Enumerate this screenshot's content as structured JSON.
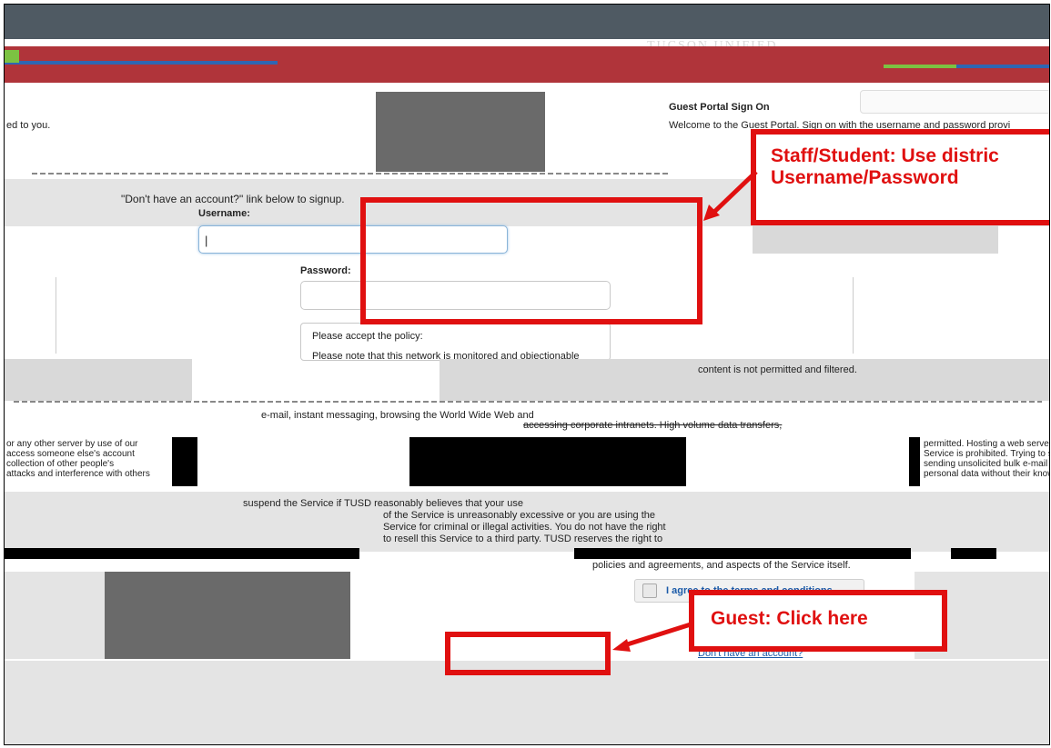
{
  "header": {
    "banner_text": "TUCSON UNIFIED",
    "colors": {
      "top_band": "#4f5a63",
      "red_band": "#b0343a",
      "accent_green": "#7cc242",
      "accent_blue": "#2f66b3"
    }
  },
  "intro": {
    "left_fragment": "ed to you.",
    "signup_hint": "\"Don't have an account?\" link below to signup."
  },
  "portal": {
    "title": "Guest Portal Sign On",
    "welcome": "Welcome to the Guest Portal. Sign on with the username and password provi"
  },
  "form": {
    "username_label": "Username:",
    "username_value": "|",
    "password_label": "Password:",
    "password_value": ""
  },
  "policy": {
    "heading": "Please accept the policy:",
    "line1": "Please note that this network is monitored and objectionable",
    "line2": "content is not permitted and filtered.",
    "email_line": "e-mail, instant messaging, browsing the World Wide Web and",
    "intranet_line": "accessing corporate intranets. High volume data transfers,",
    "left_col": [
      "or any other server by use of our",
      "access someone else's account",
      "collection of other people's",
      "attacks and interference with others"
    ],
    "right_col": [
      "permitted. Hosting a web server",
      "Service is prohibited. Trying to s",
      "sending unsolicited bulk e-mail",
      "personal data without their know"
    ],
    "suspend_lines": [
      "suspend the Service if TUSD reasonably believes that your use",
      "of the Service is unreasonably excessive or you are using the",
      "Service for criminal or illegal activities. You do not have the right",
      "to resell this Service to a third party. TUSD reserves the right to"
    ],
    "bottom_line": "policies and agreements, and aspects of the Service itself."
  },
  "agree": {
    "label": "I agree to the terms and conditions"
  },
  "links": {
    "no_account": "Don't have an account?"
  },
  "callouts": {
    "staff": {
      "line1": "Staff/Student: Use distric",
      "line2": "Username/Password"
    },
    "guest": {
      "text": "Guest: Click here"
    },
    "color": "#e01010"
  }
}
